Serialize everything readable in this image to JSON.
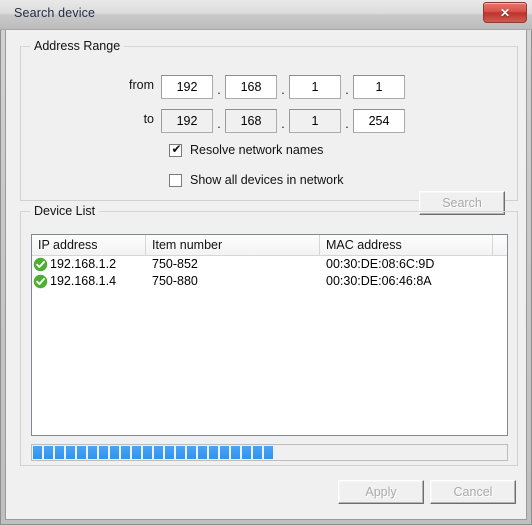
{
  "window": {
    "title": "Search device",
    "close_label": "✕"
  },
  "address_range": {
    "legend": "Address Range",
    "from_label": "from",
    "to_label": "to",
    "separator": ".",
    "from_octets": [
      "192",
      "168",
      "1",
      "1"
    ],
    "to_octets": [
      "192",
      "168",
      "1",
      "254"
    ],
    "options": {
      "resolve_names_label": "Resolve network names",
      "resolve_names_checked": true,
      "resolve_names_mark": "✔",
      "show_all_label": "Show all devices in network",
      "show_all_checked": false,
      "show_all_mark": ""
    },
    "search_button": {
      "label": "Search",
      "enabled": false
    }
  },
  "device_list": {
    "legend": "Device List",
    "columns": [
      "IP address",
      "Item number",
      "MAC address",
      ""
    ],
    "rows": [
      {
        "status": "ok",
        "ip_address": "192.168.1.2",
        "item_number": "750-852",
        "mac_address": "00:30:DE:08:6C:9D"
      },
      {
        "status": "ok",
        "ip_address": "192.168.1.4",
        "item_number": "750-880",
        "mac_address": "00:30:DE:06:46:8A"
      }
    ],
    "progress": {
      "percent": 47,
      "chunks": 22
    }
  },
  "footer": {
    "apply_label": "Apply",
    "cancel_label": "Cancel",
    "apply_enabled": false,
    "cancel_enabled": false
  },
  "colors": {
    "accent_progress": "#2f93f0",
    "status_ok": "#4caf2f",
    "close_button": "#bd342f",
    "dialog_background": "#f0f0f0"
  }
}
